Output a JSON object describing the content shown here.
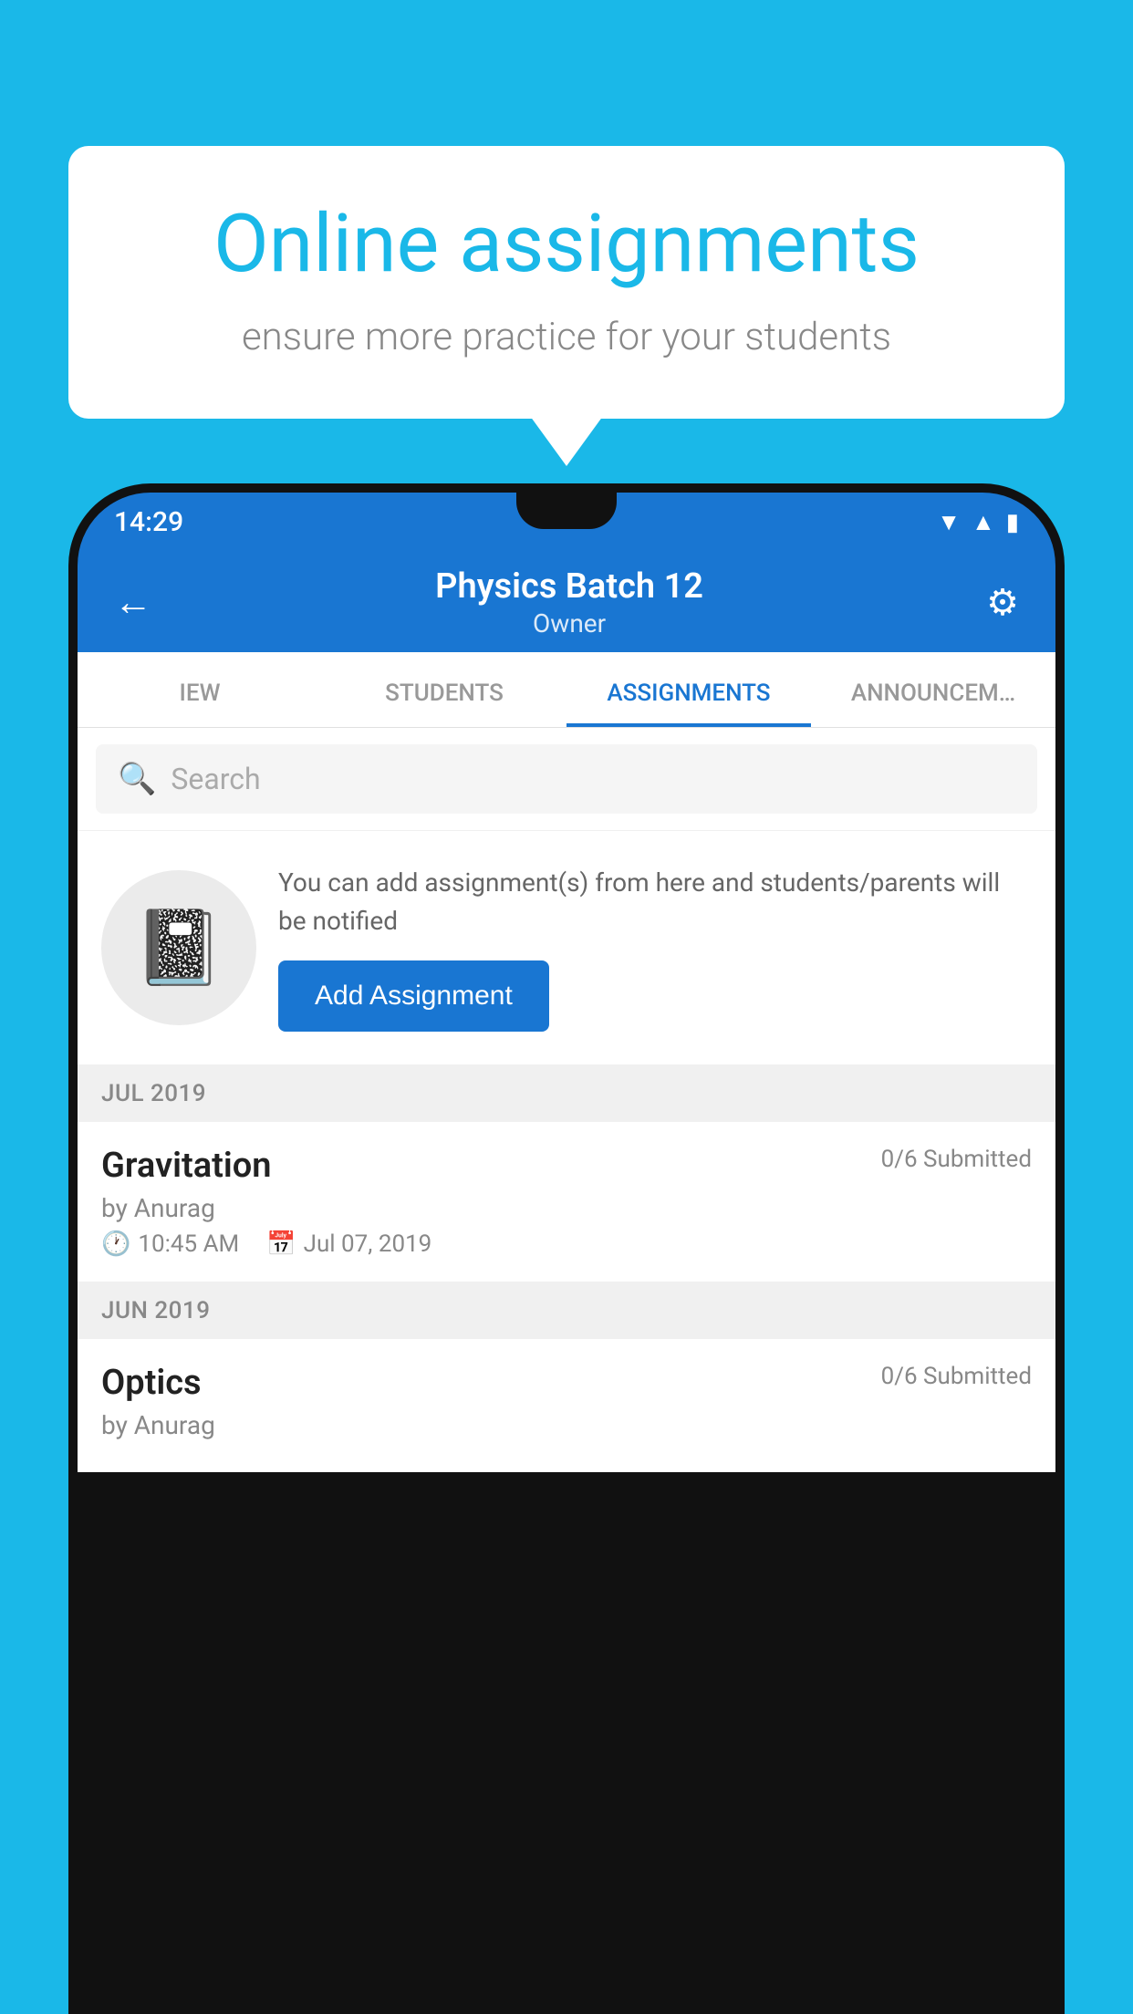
{
  "background": {
    "color": "#1ab8e8"
  },
  "speech_bubble": {
    "title": "Online assignments",
    "subtitle": "ensure more practice for your students"
  },
  "status_bar": {
    "time": "14:29",
    "icons": [
      "wifi",
      "signal",
      "battery"
    ]
  },
  "app_bar": {
    "title": "Physics Batch 12",
    "subtitle": "Owner",
    "back_label": "←",
    "settings_label": "⚙"
  },
  "tabs": [
    {
      "label": "IEW",
      "active": false
    },
    {
      "label": "STUDENTS",
      "active": false
    },
    {
      "label": "ASSIGNMENTS",
      "active": true
    },
    {
      "label": "ANNOUNCEM…",
      "active": false
    }
  ],
  "search": {
    "placeholder": "Search"
  },
  "info_section": {
    "description": "You can add assignment(s) from here and students/parents will be notified",
    "button_label": "Add Assignment"
  },
  "sections": [
    {
      "header": "JUL 2019",
      "assignments": [
        {
          "title": "Gravitation",
          "status": "0/6 Submitted",
          "author": "by Anurag",
          "time": "10:45 AM",
          "date": "Jul 07, 2019"
        }
      ]
    },
    {
      "header": "JUN 2019",
      "assignments": [
        {
          "title": "Optics",
          "status": "0/6 Submitted",
          "author": "by Anurag",
          "time": "",
          "date": ""
        }
      ]
    }
  ]
}
